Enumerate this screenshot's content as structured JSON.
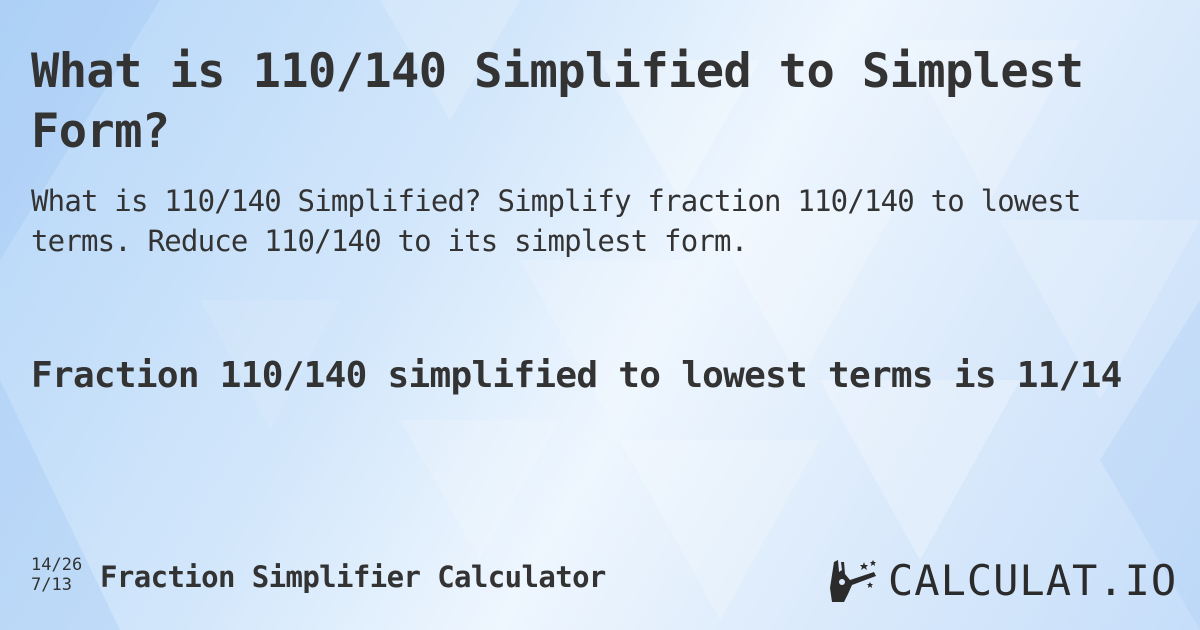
{
  "title": "What is 110/140 Simplified to Simplest Form?",
  "description": "What is 110/140 Simplified? Simplify fraction 110/140 to lowest terms. Reduce 110/140 to its simplest form.",
  "answer": "Fraction 110/140 simplified to lowest terms is 11/14",
  "footer": {
    "fraction_top": "14/26",
    "fraction_bottom": "7/13",
    "calculator_name": "Fraction Simplifier Calculator"
  },
  "logo": {
    "text": "CALCULAT.IO",
    "icon": "magic-wand-hand-icon"
  }
}
